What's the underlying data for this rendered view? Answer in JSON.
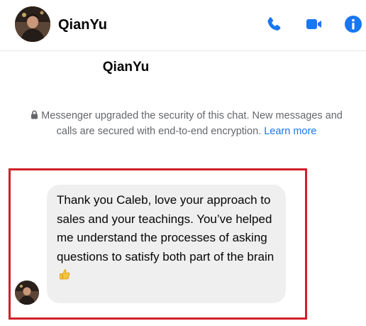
{
  "header": {
    "contact_name": "QianYu",
    "icons": [
      "phone-icon",
      "video-icon",
      "info-icon"
    ],
    "accent_color": "#1877f2"
  },
  "conversation": {
    "contact_name": "QianYu",
    "security_note": "Messenger upgraded the security of this chat. New messages and calls are secured with end-to-end encryption.",
    "learn_more_label": "Learn more"
  },
  "message": {
    "text": "Thank you Caleb, love your approach to sales and your teachings. You’ve helped me understand the processes of asking questions to satisfy both part of the brain",
    "emoji": "thumbs-up-icon",
    "bubble_color": "#efefef"
  },
  "highlight": {
    "color": "#d0202a"
  }
}
